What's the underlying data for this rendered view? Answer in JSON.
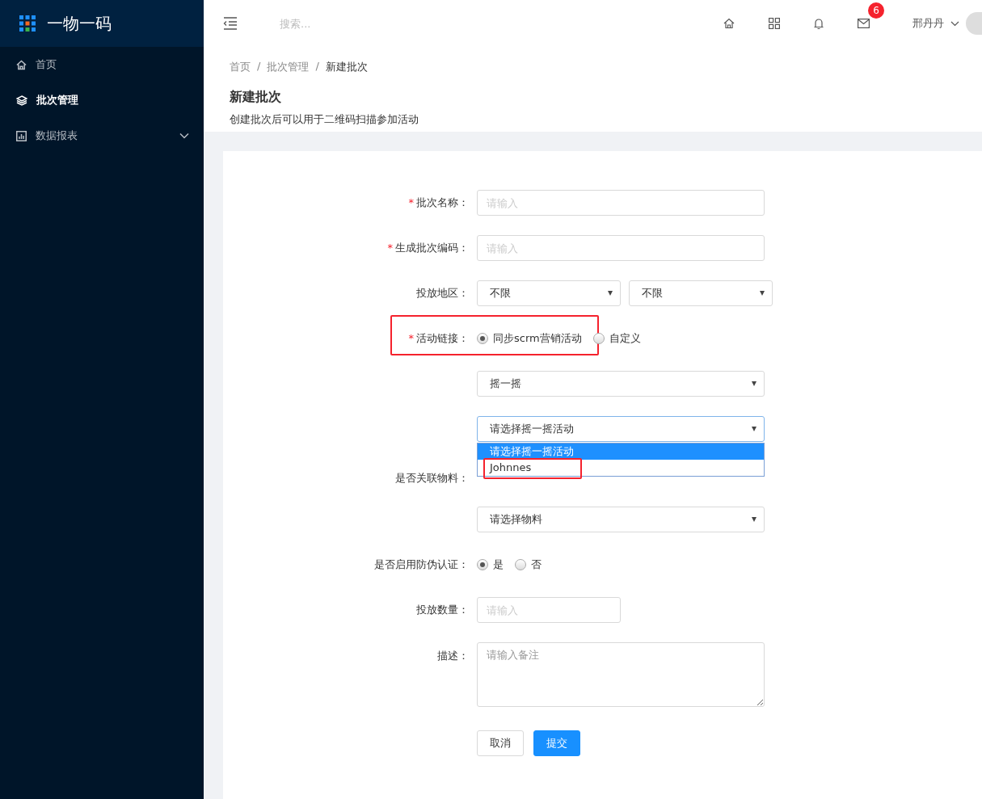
{
  "sidebar": {
    "logo_title": "一物一码",
    "items": [
      {
        "label": "首页",
        "kind": "home",
        "selected": false,
        "has_submenu": false
      },
      {
        "label": "批次管理",
        "kind": "layers",
        "selected": true,
        "has_submenu": false
      },
      {
        "label": "数据报表",
        "kind": "chart",
        "selected": false,
        "has_submenu": true
      }
    ]
  },
  "header": {
    "search": {
      "placeholder": "搜索..."
    },
    "mail_badge": "6",
    "user": "邢丹丹"
  },
  "breadcrumb": [
    {
      "label": "首页",
      "current": false
    },
    {
      "separator": "/",
      "label": "批次管理",
      "current": false
    },
    {
      "separator": "/",
      "label": "新建批次",
      "current": true
    }
  ],
  "page_title": "新建批次",
  "page_description": "创建批次后可以用于二维码扫描参加活动",
  "form": [
    {
      "kind": "input",
      "label": "批次名称：",
      "required_mark": "*",
      "placeholder": "请输入",
      "wide": true
    },
    {
      "kind": "input",
      "label": "生成批次编码：",
      "required_mark": "*",
      "placeholder": "请输入",
      "wide": true
    },
    {
      "kind": "select_pair",
      "label": "投放地区：",
      "values": [
        "不限",
        "不限"
      ]
    },
    {
      "kind": "radio",
      "label": "活动链接：",
      "required_mark": "*",
      "highlighted": true,
      "options": [
        {
          "label": "同步scrm营销活动",
          "selected": true
        },
        {
          "label": "自定义",
          "selected": false
        }
      ]
    },
    {
      "kind": "select",
      "value": "摇一摇",
      "open": false
    },
    {
      "kind": "select",
      "value": "请选择摇一摇活动",
      "open": true,
      "options": [
        {
          "label": "请选择摇一摇活动",
          "selected": true,
          "highlighted": false
        },
        {
          "label": "Johnnes",
          "selected": false,
          "highlighted": true
        }
      ]
    },
    {
      "kind": "label",
      "label": "是否关联物料："
    },
    {
      "kind": "select",
      "value": "请选择物料",
      "open": false
    },
    {
      "kind": "radio",
      "label": "是否启用防伪认证：",
      "options": [
        {
          "label": "是",
          "selected": true
        },
        {
          "label": "否",
          "selected": false
        }
      ]
    },
    {
      "kind": "input",
      "label": "投放数量：",
      "placeholder": "请输入",
      "wide": false
    },
    {
      "kind": "textarea",
      "label": "描述：",
      "placeholder": "请输入备注"
    },
    {
      "kind": "buttons",
      "buttons": [
        {
          "label": "取消",
          "primary": false
        },
        {
          "label": "提交",
          "primary": true
        }
      ]
    }
  ]
}
